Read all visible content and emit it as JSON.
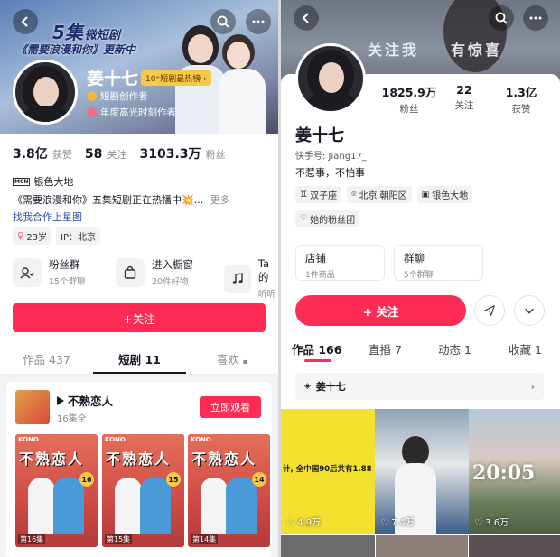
{
  "left": {
    "banner": {
      "line1": "5集",
      "line1b": "微短剧",
      "line2": "《需要浪漫和你》更新中"
    },
    "profile": {
      "name": "姜十七",
      "rank_badge": "10⁺短剧最热榜 ›",
      "creator_tag": "短剧创作者",
      "annual_tag": "年度高光时刻作者"
    },
    "stats": [
      {
        "value": "3.8亿",
        "label": "获赞"
      },
      {
        "value": "58",
        "label": "关注"
      },
      {
        "value": "3103.3万",
        "label": "粉丝"
      }
    ],
    "mcn": {
      "badge": "MCN",
      "name": "银色大地"
    },
    "bio": "《需要浪漫和你》五集短剧正在热播中💥...",
    "bio_more": "更多",
    "collab_link": "找我合作上星图",
    "tags": [
      "23岁",
      "IP：北京"
    ],
    "shortcuts": [
      {
        "title": "粉丝群",
        "sub": "15个群聊"
      },
      {
        "title": "进入橱窗",
        "sub": "20件好物"
      },
      {
        "title": "Ta的",
        "sub": "听听"
      }
    ],
    "follow_button": "+关注",
    "tabs": [
      {
        "label": "作品 437"
      },
      {
        "label": "短剧 11"
      },
      {
        "label": "喜欢"
      }
    ],
    "drama": {
      "title": "不熟恋人",
      "episodes": "16集全",
      "watch_button": "立即观看",
      "poster_title": "不熟恋人",
      "poster_brand": "KONO",
      "posters": [
        {
          "episode": "第16集",
          "num": "16"
        },
        {
          "episode": "第15集",
          "num": "15"
        },
        {
          "episode": "第14集",
          "num": "14"
        }
      ]
    }
  },
  "right": {
    "banner_text": [
      "关注我",
      "有惊喜"
    ],
    "stats": [
      {
        "value": "1825.9万",
        "label": "粉丝"
      },
      {
        "value": "22",
        "label": "关注"
      },
      {
        "value": "1.3亿",
        "label": "获赞"
      }
    ],
    "name": "姜十七",
    "kuaishou_id": "快手号: Jiang17_",
    "bio": "不惹事，不怕事",
    "tags": [
      "双子座",
      "北京 朝阳区",
      "银色大地"
    ],
    "fan_group": "她的粉丝团",
    "cards": [
      {
        "title": "店铺",
        "sub": "1件商品"
      },
      {
        "title": "群聊",
        "sub": "5个群聊"
      }
    ],
    "follow_button": "+ 关注",
    "tabs": [
      {
        "label": "作品 166"
      },
      {
        "label": "直播 7"
      },
      {
        "label": "动态 1"
      },
      {
        "label": "收藏 1"
      }
    ],
    "collection": "姜十七",
    "videos": [
      {
        "caption": "计, 全中国90后共有1.88",
        "likes": "4.9万"
      },
      {
        "caption": "",
        "likes": "7.4万"
      },
      {
        "caption": "20:05",
        "likes": "3.6万"
      }
    ]
  },
  "colors": {
    "accent": "#fe2c55",
    "text": "#161823",
    "gray": "#8a8b91"
  }
}
